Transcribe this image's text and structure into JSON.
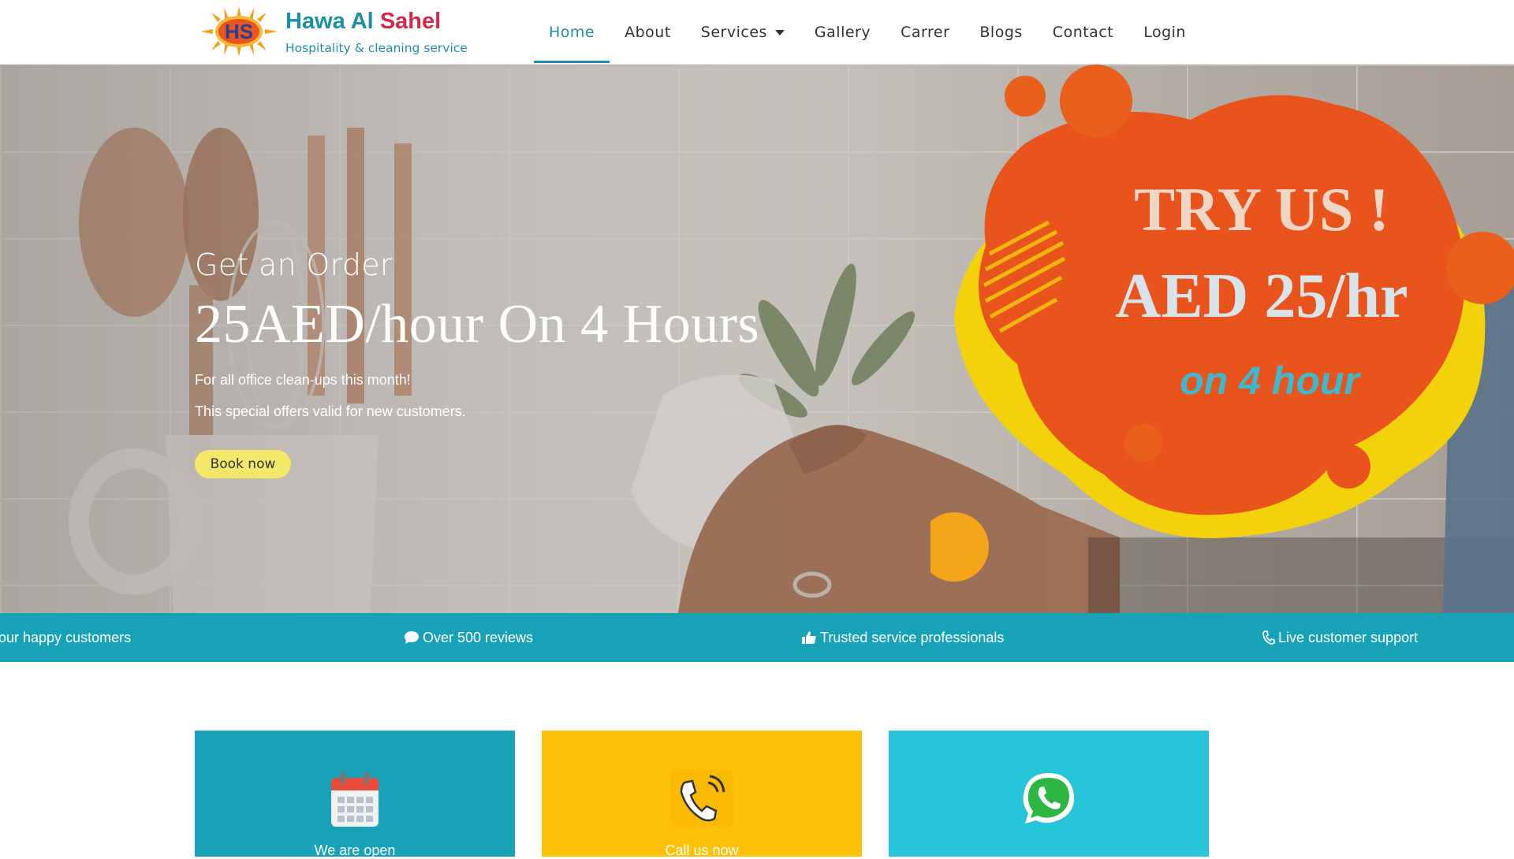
{
  "brand": {
    "name_part1": "Hawa Al",
    "name_part2": "Sahel",
    "tagline": "Hospitality & cleaning service",
    "logo_text": "HS",
    "colors": {
      "primary": "#1f8fa6",
      "accent": "#d4284a"
    }
  },
  "nav": {
    "items": [
      {
        "label": "Home",
        "active": true
      },
      {
        "label": "About"
      },
      {
        "label": "Services",
        "dropdown": true
      },
      {
        "label": "Gallery"
      },
      {
        "label": "Carrer"
      },
      {
        "label": "Blogs"
      },
      {
        "label": "Contact"
      },
      {
        "label": "Login"
      }
    ]
  },
  "hero": {
    "kicker": "Get an Order",
    "title": "25AED/hour On 4 Hours",
    "line1": "For all office clean-ups this month!",
    "line2": "This special offers valid for new customers.",
    "cta": "Book now",
    "promo": {
      "line1": "TRY US !",
      "line2": "AED 25/hr",
      "line3": "on 4 hour"
    }
  },
  "ticker": {
    "items": [
      "our happy customers",
      "Over 500 reviews",
      "Trusted service professionals",
      "Live customer support"
    ],
    "icons": [
      "comment-icon",
      "thumbs-up-icon",
      "phone-icon"
    ],
    "color": "#17a2b8"
  },
  "cards": [
    {
      "label": "We are open",
      "icon": "calendar-icon",
      "color": "#17a2b8"
    },
    {
      "label": "Call us now",
      "icon": "phone-icon",
      "color": "#ffc107"
    },
    {
      "label": "",
      "icon": "whatsapp-icon",
      "color": "#26c5da"
    }
  ]
}
